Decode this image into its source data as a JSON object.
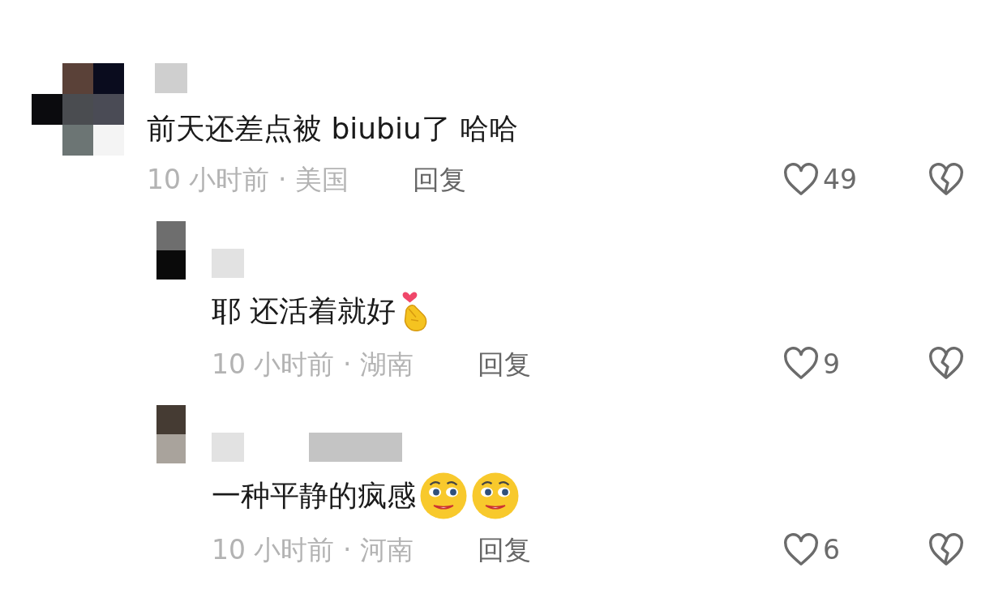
{
  "comments": [
    {
      "text": "前天还差点被 biubiu了 哈哈",
      "meta": "10 小时前 · 美国",
      "reply": "回复",
      "likes": "49",
      "children": [
        {
          "text": "耶 还活着就好",
          "emojis": [
            {
              "kind": "finger-heart"
            }
          ],
          "meta": "10 小时前 · 湖南",
          "reply": "回复",
          "likes": "9"
        },
        {
          "text": "一种平静的疯感",
          "emojis": [
            {
              "kind": "pleading-face"
            },
            {
              "kind": "pleading-face"
            }
          ],
          "meta": "10 小时前 · 河南",
          "reply": "回复",
          "likes": "6"
        }
      ]
    }
  ]
}
